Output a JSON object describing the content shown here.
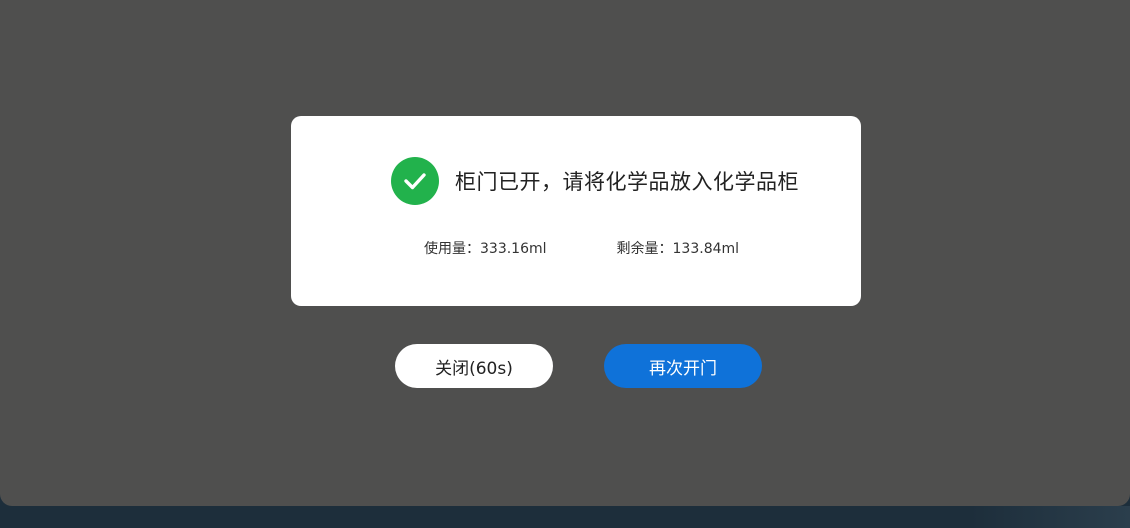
{
  "dialog": {
    "status_icon": "check-circle-icon",
    "status_text": "柜门已开，请将化学品放入化学品柜",
    "usage": {
      "used_label": "使用量：",
      "used_value": "333.16ml",
      "remaining_label": "剩余量：",
      "remaining_value": "133.84ml"
    }
  },
  "buttons": {
    "close_label": "关闭(60s)",
    "reopen_label": "再次开门"
  },
  "colors": {
    "success": "#22b24c",
    "primary": "#0f72d9",
    "overlay": "#4f4f4e"
  }
}
